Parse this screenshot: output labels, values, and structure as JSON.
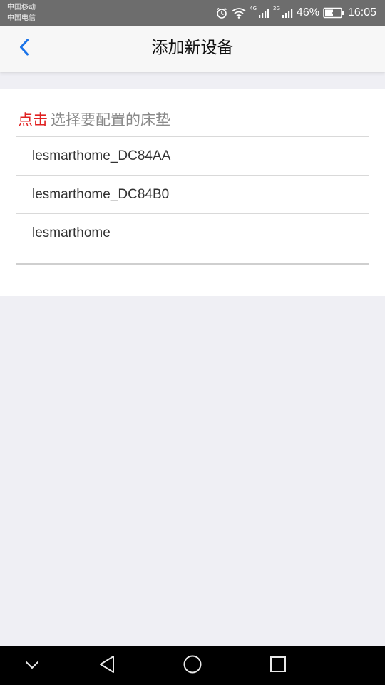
{
  "status_bar": {
    "carrier_1": "中国移动",
    "carrier_2": "中国电信",
    "net_1": "4G",
    "net_2": "2G",
    "battery_percent": "46%",
    "time": "16:05"
  },
  "nav": {
    "title": "添加新设备",
    "back_icon": "chevron-left-icon"
  },
  "instruction": {
    "tap_label": "点击",
    "hint": "选择要配置的床垫"
  },
  "devices": [
    {
      "name": "lesmarthome_DC84AA"
    },
    {
      "name": "lesmarthome_DC84B0"
    },
    {
      "name": "lesmarthome"
    }
  ],
  "colors": {
    "accent_blue": "#1a73e8",
    "tap_red": "#e02222",
    "status_bar": "#6d6d6d",
    "background": "#efeff4"
  },
  "system_nav": {
    "icons": [
      "chevron-down-icon",
      "back-triangle-icon",
      "home-circle-icon",
      "recents-square-icon"
    ]
  }
}
